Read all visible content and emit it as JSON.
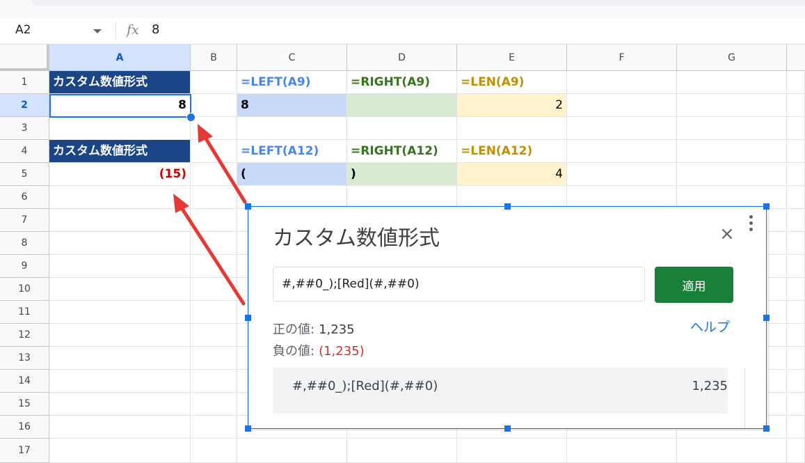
{
  "formula_bar": {
    "cell_ref": "A2",
    "fx_label": "fx",
    "value": "8"
  },
  "columns": [
    "A",
    "B",
    "C",
    "D",
    "E",
    "F",
    "G"
  ],
  "rows": [
    "1",
    "2",
    "3",
    "4",
    "5",
    "6",
    "7",
    "8",
    "9",
    "10",
    "11",
    "12",
    "13",
    "14",
    "15",
    "16",
    "17"
  ],
  "cells": {
    "A1": "カスタム数値形式",
    "C1": "=LEFT(A9)",
    "D1": "=RIGHT(A9)",
    "E1": "=LEN(A9)",
    "A2": "8",
    "C2": "8",
    "E2": "2",
    "A4": "カスタム数値形式",
    "C4": "=LEFT(A12)",
    "D4": "=RIGHT(A12)",
    "E4": "=LEN(A12)",
    "A5": "(15)",
    "C5": "(",
    "D5": ")",
    "E5": "4"
  },
  "dialog": {
    "title": "カスタム数値形式",
    "close": "×",
    "format_input": "#,##0_);[Red](#,##0)",
    "apply_label": "適用",
    "help_label": "ヘルプ",
    "positive_label": "正の値:",
    "positive_value": "1,235",
    "negative_label": "負の値:",
    "negative_value": "(1,235)",
    "list_item_format": "#,##0_);[Red](#,##0)",
    "list_item_preview": "1,235"
  },
  "colors": {
    "header_fill": "#1c4587",
    "accent": "#1a73e8",
    "apply_green": "#188038",
    "arrow_red": "#e53935",
    "negative_red": "#d93025"
  }
}
